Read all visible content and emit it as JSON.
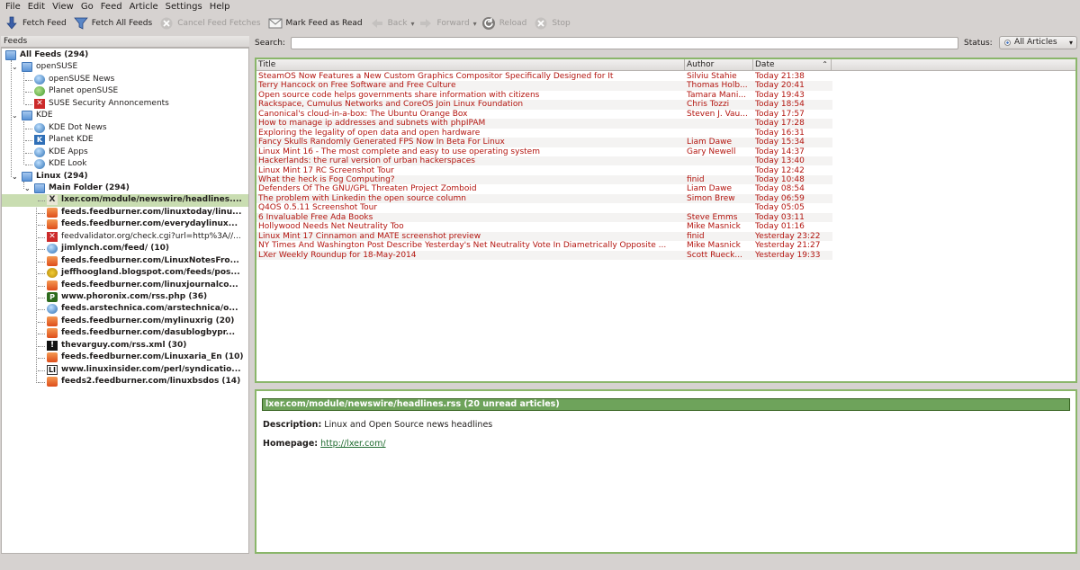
{
  "menu": [
    "File",
    "Edit",
    "View",
    "Go",
    "Feed",
    "Article",
    "Settings",
    "Help"
  ],
  "toolbar": {
    "fetch_feed": "Fetch Feed",
    "fetch_all": "Fetch All Feeds",
    "cancel": "Cancel Feed Fetches",
    "mark_read": "Mark Feed as Read",
    "back": "Back",
    "forward": "Forward",
    "reload": "Reload",
    "stop": "Stop"
  },
  "feeds": {
    "header": "Feeds",
    "items": [
      {
        "label": "All Feeds (294)",
        "icon": "folder",
        "bold": true
      },
      {
        "label": "openSUSE",
        "icon": "folder",
        "bold": false
      },
      {
        "label": "openSUSE News",
        "icon": "globe",
        "bold": false
      },
      {
        "label": "Planet openSUSE",
        "icon": "green",
        "bold": false
      },
      {
        "label": "SUSE Security Annoncements",
        "icon": "redx",
        "bold": false
      },
      {
        "label": "KDE",
        "icon": "folder",
        "bold": false
      },
      {
        "label": "KDE Dot News",
        "icon": "globe",
        "bold": false
      },
      {
        "label": "Planet KDE",
        "icon": "kde",
        "bold": false
      },
      {
        "label": "KDE Apps",
        "icon": "globe",
        "bold": false
      },
      {
        "label": "KDE Look",
        "icon": "globe",
        "bold": false
      },
      {
        "label": "Linux (294)",
        "icon": "folder",
        "bold": true
      },
      {
        "label": "Main Folder (294)",
        "icon": "folder",
        "bold": true
      },
      {
        "label": "lxer.com/module/newswire/headlines....",
        "icon": "x",
        "bold": true
      },
      {
        "label": "feeds.feedburner.com/linuxtoday/linu...",
        "icon": "fb",
        "bold": true
      },
      {
        "label": "feeds.feedburner.com/everydaylinux...",
        "icon": "fb",
        "bold": true
      },
      {
        "label": "feedvalidator.org/check.cgi?url=http%3A//...",
        "icon": "redx",
        "bold": false
      },
      {
        "label": "jimlynch.com/feed/ (10)",
        "icon": "globe",
        "bold": true
      },
      {
        "label": "feeds.feedburner.com/LinuxNotesFro...",
        "icon": "fb",
        "bold": true
      },
      {
        "label": "jeffhoogland.blogspot.com/feeds/pos...",
        "icon": "blog",
        "bold": true
      },
      {
        "label": "feeds.feedburner.com/linuxjournalco...",
        "icon": "fb",
        "bold": true
      },
      {
        "label": "www.phoronix.com/rss.php (36)",
        "icon": "pho",
        "bold": true
      },
      {
        "label": "feeds.arstechnica.com/arstechnica/o...",
        "icon": "globe",
        "bold": true
      },
      {
        "label": "feeds.feedburner.com/mylinuxrig (20)",
        "icon": "fb",
        "bold": true
      },
      {
        "label": "feeds.feedburner.com/dasublogbypr...",
        "icon": "fb",
        "bold": true
      },
      {
        "label": "thevarguy.com/rss.xml (30)",
        "icon": "excl",
        "bold": true
      },
      {
        "label": "feeds.feedburner.com/Linuxaria_En (10)",
        "icon": "fb",
        "bold": true
      },
      {
        "label": "www.linuxinsider.com/perl/syndicatio...",
        "icon": "li",
        "bold": true
      },
      {
        "label": "feeds2.feedburner.com/linuxbsdos (14)",
        "icon": "fb",
        "bold": true
      }
    ]
  },
  "search": {
    "label": "Search:",
    "value": ""
  },
  "status": {
    "label": "Status:",
    "value": "All Articles"
  },
  "articles": {
    "columns": [
      "Title",
      "Author",
      "Date"
    ],
    "rows": [
      [
        "SteamOS Now Features a New Custom Graphics Compositor Specifically Designed for It",
        "Silviu Stahie",
        "Today 21:38"
      ],
      [
        "Terry Hancock on Free Software and Free Culture",
        "Thomas Holb...",
        "Today 20:41"
      ],
      [
        "Open source code helps governments share information with citizens",
        "Tamara Mani...",
        "Today 19:43"
      ],
      [
        "Rackspace, Cumulus Networks and CoreOS Join Linux Foundation",
        "Chris Tozzi",
        "Today 18:54"
      ],
      [
        "Canonical's cloud-in-a-box: The Ubuntu Orange Box",
        "Steven J. Vau...",
        "Today 17:57"
      ],
      [
        "How to manage ip addresses and subnets with phpIPAM",
        "",
        "Today 17:28"
      ],
      [
        "Exploring the legality of open data and open hardware",
        "",
        "Today 16:31"
      ],
      [
        "Fancy Skulls Randomly Generated FPS Now In Beta For Linux",
        "Liam Dawe",
        "Today 15:34"
      ],
      [
        "Linux Mint 16 - The most complete and easy to use operating system",
        "Gary Newell",
        "Today 14:37"
      ],
      [
        "Hackerlands: the rural version of urban hackerspaces",
        "",
        "Today 13:40"
      ],
      [
        "Linux Mint 17 RC Screenshot Tour",
        "",
        "Today 12:42"
      ],
      [
        "What the heck is Fog Computing?",
        "finid",
        "Today 10:48"
      ],
      [
        "Defenders Of The GNU/GPL Threaten Project Zomboid",
        "Liam Dawe",
        "Today 08:54"
      ],
      [
        "The problem with Linkedin the open source column",
        "Simon Brew",
        "Today 06:59"
      ],
      [
        "Q4OS 0.5.11 Screenshot Tour",
        "",
        "Today 05:05"
      ],
      [
        "6 Invaluable Free Ada Books",
        "Steve Emms",
        "Today 03:11"
      ],
      [
        "Hollywood Needs Net Neutrality Too",
        "Mike Masnick",
        "Today 01:16"
      ],
      [
        "Linux Mint 17 Cinnamon and MATE screenshot preview",
        "finid",
        "Yesterday 23:22"
      ],
      [
        "NY Times And Washington Post Describe Yesterday's Net Neutrality Vote In Diametrically Opposite ...",
        "Mike Masnick",
        "Yesterday 21:27"
      ],
      [
        "LXer Weekly Roundup for 18-May-2014",
        "Scott Rueck...",
        "Yesterday 19:33"
      ]
    ]
  },
  "viewer": {
    "title": "lxer.com/module/newswire/headlines.rss (20 unread articles)",
    "desc_label": "Description:",
    "desc_value": "Linux and Open Source news headlines",
    "home_label": "Homepage:",
    "home_value": "http://lxer.com/"
  },
  "colors": {
    "accent": "#6ea35b",
    "unread": "#b3150f",
    "selected": "#c9ddb1"
  }
}
